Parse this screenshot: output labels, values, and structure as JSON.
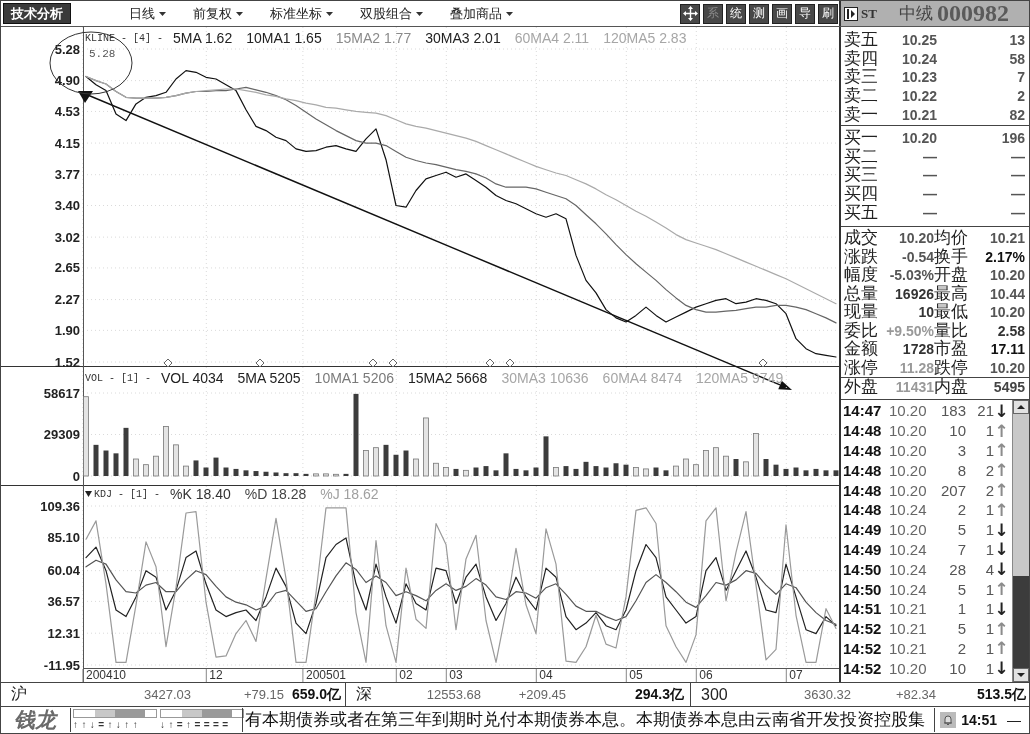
{
  "toolbar": {
    "title": "技术分析",
    "menus": [
      "日线",
      "前复权",
      "标准坐标",
      "双股组合",
      "叠加商品"
    ],
    "tools": [
      {
        "label": "系",
        "disabled": true
      },
      {
        "label": "统",
        "disabled": false
      },
      {
        "label": "测",
        "disabled": false
      },
      {
        "label": "画",
        "disabled": false
      },
      {
        "label": "导",
        "disabled": false
      },
      {
        "label": "刷",
        "disabled": false
      }
    ]
  },
  "stock": {
    "prefix": "ST",
    "name": "中绒",
    "code": "000982"
  },
  "price_pane": {
    "title": "KLINE - [4] -",
    "legend": [
      {
        "text": "5MA 1.62",
        "color": "#222222"
      },
      {
        "text": "10MA1 1.65",
        "color": "#222222"
      },
      {
        "text": "15MA2 1.77",
        "color": "#8a8a8a"
      },
      {
        "text": "30MA3 2.01",
        "color": "#222222"
      },
      {
        "text": "60MA4 2.11",
        "color": "#a6a6a6"
      },
      {
        "text": "120MA5 2.83",
        "color": "#a6a6a6"
      }
    ],
    "chart_data": {
      "type": "line",
      "grid": true,
      "ylim": [
        1.52,
        5.28
      ],
      "yticks": [
        {
          "value": 5.28,
          "label": "5.28"
        },
        {
          "value": 4.9,
          "label": "4.90"
        },
        {
          "value": 4.53,
          "label": "4.53"
        },
        {
          "value": 4.15,
          "label": "4.15"
        },
        {
          "value": 3.77,
          "label": "3.77"
        },
        {
          "value": 3.4,
          "label": "3.40"
        },
        {
          "value": 3.02,
          "label": "3.02"
        },
        {
          "value": 2.65,
          "label": "2.65"
        },
        {
          "value": 2.27,
          "label": "2.27"
        },
        {
          "value": 1.9,
          "label": "1.90"
        },
        {
          "value": 1.52,
          "label": "1.52"
        }
      ],
      "series": [
        {
          "color": "#111111",
          "values": [
            4.95,
            4.85,
            4.78,
            4.5,
            4.42,
            4.62,
            4.7,
            4.72,
            4.76,
            4.92,
            5.02,
            5.0,
            4.94,
            4.92,
            4.85,
            4.78,
            4.55,
            4.35,
            4.3,
            4.22,
            4.18,
            4.08,
            4.05,
            4.06,
            4.1,
            4.12,
            4.08,
            4.05,
            4.2,
            4.32,
            3.95,
            3.4,
            3.38,
            3.58,
            3.72,
            3.76,
            3.8,
            3.74,
            3.78,
            3.7,
            3.62,
            3.52,
            3.46,
            3.42,
            3.36,
            3.3,
            3.26,
            3.3,
            3.24,
            2.8,
            2.5,
            2.35,
            2.15,
            2.05,
            2.0,
            2.08,
            2.18,
            2.08,
            2.0,
            2.06,
            2.12,
            2.18,
            2.22,
            2.26,
            2.28,
            2.22,
            2.24,
            2.28,
            2.26,
            2.22,
            2.1,
            1.8,
            1.68,
            1.62,
            1.6,
            1.58
          ]
        },
        {
          "color": "#666666",
          "values": [
            4.95,
            4.9,
            4.86,
            4.77,
            4.7,
            4.69,
            4.69,
            4.69,
            4.7,
            4.72,
            4.75,
            4.77,
            4.77,
            4.78,
            4.78,
            4.8,
            4.82,
            4.79,
            4.76,
            4.72,
            4.67,
            4.6,
            4.52,
            4.44,
            4.37,
            4.3,
            4.24,
            4.18,
            4.15,
            4.15,
            4.12,
            4.05,
            3.98,
            3.94,
            3.91,
            3.89,
            3.86,
            3.83,
            3.81,
            3.78,
            3.73,
            3.66,
            3.62,
            3.62,
            3.62,
            3.6,
            3.56,
            3.52,
            3.48,
            3.4,
            3.29,
            3.18,
            3.06,
            2.93,
            2.81,
            2.7,
            2.6,
            2.5,
            2.39,
            2.29,
            2.2,
            2.15,
            2.12,
            2.12,
            2.13,
            2.14,
            2.16,
            2.18,
            2.18,
            2.2,
            2.2,
            2.18,
            2.15,
            2.1,
            2.05,
            1.99
          ]
        },
        {
          "color": "#aaaaaa",
          "values": [
            4.95,
            4.9,
            4.86,
            4.77,
            4.7,
            4.69,
            4.69,
            4.69,
            4.7,
            4.72,
            4.75,
            4.77,
            4.78,
            4.79,
            4.8,
            4.8,
            4.78,
            4.76,
            4.73,
            4.71,
            4.68,
            4.66,
            4.63,
            4.61,
            4.58,
            4.57,
            4.55,
            4.53,
            4.52,
            4.51,
            4.48,
            4.43,
            4.38,
            4.35,
            4.33,
            4.3,
            4.27,
            4.24,
            4.21,
            4.17,
            4.12,
            4.07,
            4.02,
            3.97,
            3.92,
            3.87,
            3.83,
            3.79,
            3.76,
            3.71,
            3.66,
            3.6,
            3.53,
            3.47,
            3.4,
            3.33,
            3.27,
            3.2,
            3.13,
            3.05,
            2.99,
            2.95,
            2.91,
            2.87,
            2.82,
            2.77,
            2.72,
            2.67,
            2.62,
            2.57,
            2.52,
            2.46,
            2.4,
            2.34,
            2.28,
            2.22
          ]
        }
      ],
      "annotations": [
        {
          "text": "5.28"
        }
      ]
    }
  },
  "volume_pane": {
    "title": "VOL - [1] -",
    "legend": [
      {
        "text": "VOL 4034",
        "color": "#222222"
      },
      {
        "text": "5MA 5205",
        "color": "#222222"
      },
      {
        "text": "10MA1 5206",
        "color": "#7a7a7a"
      },
      {
        "text": "15MA2 5668",
        "color": "#222222"
      },
      {
        "text": "30MA3 10636",
        "color": "#a6a6a6"
      },
      {
        "text": "60MA4 8474",
        "color": "#a6a6a6"
      },
      {
        "text": "120MA5 9749",
        "color": "#a6a6a6"
      }
    ],
    "chart_data": {
      "type": "bar",
      "grid": true,
      "ylim": [
        0,
        58617
      ],
      "yticks": [
        {
          "value": 58617,
          "label": "58617"
        },
        {
          "value": 29309,
          "label": "29309"
        },
        {
          "value": 0,
          "label": "0"
        }
      ],
      "values": [
        56000,
        22000,
        18000,
        16000,
        34000,
        12000,
        8000,
        14000,
        35000,
        22000,
        7000,
        11000,
        6000,
        13000,
        6000,
        5000,
        4000,
        3500,
        3000,
        2500,
        2000,
        2000,
        1500,
        1500,
        1500,
        1200,
        1500,
        58000,
        18000,
        20000,
        22000,
        15000,
        18000,
        12000,
        41000,
        9000,
        6000,
        5000,
        4000,
        6000,
        7000,
        4000,
        16000,
        5000,
        4000,
        6000,
        28000,
        6000,
        7000,
        5000,
        10000,
        7000,
        6000,
        9000,
        8000,
        6000,
        5000,
        6000,
        4000,
        7000,
        12000,
        8000,
        18000,
        20000,
        14000,
        12000,
        10000,
        30000,
        12000,
        8000,
        5000,
        6000,
        4000,
        5000,
        4000,
        4000
      ]
    }
  },
  "kdj_pane": {
    "title": "KDJ - [1] -",
    "legend": [
      {
        "text": "%K 18.40",
        "color": "#333333"
      },
      {
        "text": "%D 18.28",
        "color": "#444444"
      },
      {
        "text": "%J 18.62",
        "color": "#a0a0a0"
      }
    ],
    "chart_data": {
      "type": "line",
      "grid": true,
      "ylim": [
        -11.95,
        109.36
      ],
      "yticks": [
        {
          "value": 109.36,
          "label": "109.36"
        },
        {
          "value": 85.1,
          "label": "85.10"
        },
        {
          "value": 60.04,
          "label": "60.04"
        },
        {
          "value": 36.57,
          "label": "36.57"
        },
        {
          "value": 12.31,
          "label": "12.31"
        },
        {
          "value": -11.95,
          "label": "-11.95"
        }
      ],
      "categories": [
        null,
        null,
        "200410",
        null,
        null,
        null,
        null,
        null,
        null,
        null,
        null,
        null,
        null,
        "12",
        null,
        null,
        null,
        null,
        null,
        null,
        null,
        null,
        null,
        null,
        "200501",
        null,
        null,
        null,
        null,
        null,
        null,
        null,
        "02",
        null,
        null,
        null,
        null,
        "03",
        null,
        null,
        null,
        null,
        null,
        null,
        null,
        null,
        "04",
        null,
        null,
        null,
        null,
        null,
        null,
        null,
        null,
        "05",
        null,
        null,
        null,
        null,
        null,
        null,
        "06",
        null,
        null,
        null,
        null,
        null,
        null,
        null,
        null,
        "07",
        null,
        null,
        null,
        null
      ],
      "series": [
        {
          "color": "#222222",
          "values": [
            70,
            78,
            60,
            30,
            25,
            40,
            60,
            55,
            30,
            45,
            70,
            75,
            50,
            30,
            25,
            28,
            30,
            22,
            40,
            62,
            48,
            20,
            12,
            35,
            70,
            80,
            85,
            50,
            30,
            65,
            40,
            20,
            50,
            35,
            30,
            62,
            60,
            35,
            55,
            65,
            40,
            22,
            35,
            55,
            40,
            30,
            62,
            55,
            25,
            15,
            20,
            28,
            18,
            15,
            30,
            60,
            80,
            70,
            40,
            30,
            20,
            25,
            60,
            70,
            45,
            60,
            75,
            55,
            30,
            28,
            65,
            40,
            15,
            12,
            25,
            18
          ]
        },
        {
          "color": "#555555",
          "values": [
            63,
            68,
            65,
            53,
            44,
            43,
            49,
            51,
            44,
            44,
            53,
            60,
            57,
            48,
            40,
            36,
            34,
            30,
            33,
            43,
            45,
            37,
            29,
            31,
            44,
            56,
            66,
            61,
            51,
            56,
            51,
            41,
            44,
            41,
            37,
            45,
            50,
            45,
            48,
            54,
            49,
            40,
            38,
            44,
            43,
            39,
            47,
            50,
            42,
            33,
            29,
            29,
            25,
            22,
            25,
            37,
            51,
            57,
            51,
            44,
            36,
            32,
            41,
            51,
            49,
            53,
            60,
            58,
            49,
            42,
            50,
            47,
            36,
            28,
            22,
            19
          ]
        },
        {
          "color": "#9a9a9a",
          "values": [
            84,
            98,
            50,
            -10,
            -10,
            34,
            82,
            63,
            2,
            47,
            104,
            105,
            36,
            -6,
            -5,
            12,
            22,
            6,
            54,
            100,
            54,
            -10,
            -10,
            43,
            108,
            108,
            108,
            28,
            -10,
            83,
            18,
            -10,
            62,
            23,
            16,
            96,
            80,
            15,
            69,
            87,
            22,
            -10,
            29,
            77,
            34,
            12,
            92,
            65,
            -9,
            -10,
            2,
            26,
            4,
            1,
            40,
            106,
            108,
            96,
            18,
            2,
            -10,
            11,
            98,
            108,
            37,
            74,
            105,
            49,
            -8,
            0,
            95,
            26,
            -10,
            -10,
            31,
            16
          ]
        }
      ]
    }
  },
  "quote": {
    "asks": [
      {
        "label": "卖五",
        "price": "10.25",
        "volume": "13"
      },
      {
        "label": "卖四",
        "price": "10.24",
        "volume": "58"
      },
      {
        "label": "卖三",
        "price": "10.23",
        "volume": "7"
      },
      {
        "label": "卖二",
        "price": "10.22",
        "volume": "2"
      },
      {
        "label": "卖一",
        "price": "10.21",
        "volume": "82"
      }
    ],
    "bids": [
      {
        "label": "买一",
        "price": "10.20",
        "volume": "196"
      },
      {
        "label": "买二",
        "price": "—",
        "volume": "—"
      },
      {
        "label": "买三",
        "price": "—",
        "volume": "—"
      },
      {
        "label": "买四",
        "price": "—",
        "volume": "—"
      },
      {
        "label": "买五",
        "price": "—",
        "volume": "—"
      }
    ],
    "stats": [
      {
        "label": "成交",
        "value": "10.20",
        "color": "#555555"
      },
      {
        "label": "均价",
        "value": "10.21",
        "color": "#555555"
      },
      {
        "label": "涨跌",
        "value": "-0.54",
        "color": "#555555"
      },
      {
        "label": "换手",
        "value": "2.17%",
        "color": "#111111"
      },
      {
        "label": "幅度",
        "value": "-5.03%",
        "color": "#555555"
      },
      {
        "label": "开盘",
        "value": "10.20",
        "color": "#555555"
      },
      {
        "label": "总量",
        "value": "16926",
        "color": "#333333"
      },
      {
        "label": "最高",
        "value": "10.44",
        "color": "#555555"
      },
      {
        "label": "现量",
        "value": "10",
        "color": "#333333"
      },
      {
        "label": "最低",
        "value": "10.20",
        "color": "#555555"
      },
      {
        "label": "委比",
        "value": "+9.50%",
        "color": "#999999"
      },
      {
        "label": "量比",
        "value": "2.58",
        "color": "#333333"
      },
      {
        "label": "金额",
        "value": "1728",
        "color": "#333333"
      },
      {
        "label": "市盈",
        "value": "17.11",
        "color": "#111111"
      },
      {
        "label": "涨停",
        "value": "11.28",
        "color": "#999999"
      },
      {
        "label": "跌停",
        "value": "10.20",
        "color": "#555555"
      }
    ],
    "flow": [
      {
        "label": "外盘",
        "value": "11431",
        "color": "#999999"
      },
      {
        "label": "内盘",
        "value": "5495",
        "color": "#444444"
      }
    ],
    "trades": [
      {
        "time": "14:47",
        "price": "10.20",
        "volume": "183",
        "count": "21",
        "arrow": "↓",
        "color": "#222222"
      },
      {
        "time": "14:48",
        "price": "10.20",
        "volume": "10",
        "count": "1",
        "arrow": "↑",
        "color": "#8c8c8c"
      },
      {
        "time": "14:48",
        "price": "10.20",
        "volume": "3",
        "count": "1",
        "arrow": "↑",
        "color": "#8c8c8c"
      },
      {
        "time": "14:48",
        "price": "10.20",
        "volume": "8",
        "count": "2",
        "arrow": "↑",
        "color": "#8c8c8c"
      },
      {
        "time": "14:48",
        "price": "10.20",
        "volume": "207",
        "count": "2",
        "arrow": "↑",
        "color": "#8c8c8c"
      },
      {
        "time": "14:48",
        "price": "10.24",
        "volume": "2",
        "count": "1",
        "arrow": "↑",
        "color": "#8c8c8c"
      },
      {
        "time": "14:49",
        "price": "10.20",
        "volume": "5",
        "count": "1",
        "arrow": "↓",
        "color": "#222222"
      },
      {
        "time": "14:49",
        "price": "10.24",
        "volume": "7",
        "count": "1",
        "arrow": "↓",
        "color": "#222222"
      },
      {
        "time": "14:50",
        "price": "10.24",
        "volume": "28",
        "count": "4",
        "arrow": "↓",
        "color": "#222222"
      },
      {
        "time": "14:50",
        "price": "10.24",
        "volume": "5",
        "count": "1",
        "arrow": "↑",
        "color": "#8c8c8c"
      },
      {
        "time": "14:51",
        "price": "10.21",
        "volume": "1",
        "count": "1",
        "arrow": "↓",
        "color": "#222222"
      },
      {
        "time": "14:52",
        "price": "10.21",
        "volume": "5",
        "count": "1",
        "arrow": "↑",
        "color": "#8c8c8c"
      },
      {
        "time": "14:52",
        "price": "10.21",
        "volume": "2",
        "count": "1",
        "arrow": "↑",
        "color": "#8c8c8c"
      },
      {
        "time": "14:52",
        "price": "10.20",
        "volume": "10",
        "count": "1",
        "arrow": "↓",
        "color": "#222222"
      }
    ]
  },
  "indices": [
    {
      "market": "沪",
      "value": "3427.03",
      "change": "+79.15",
      "turnover": "659.0亿"
    },
    {
      "market": "深",
      "value": "12553.68",
      "change": "+209.45",
      "turnover": "294.3亿"
    },
    {
      "market": "300",
      "value": "3630.32",
      "change": "+82.34",
      "turnover": "513.5亿"
    }
  ],
  "ticker": {
    "logo": "钱龙",
    "signals": [
      "↑↑↓=↑↓↑↑",
      "↓↑=↑===="
    ],
    "news": "有本期债券或者在第三年到期时兑付本期债券本息。本期债券本息由云南省开发投资控股集",
    "time": "14:51",
    "status": "—"
  }
}
